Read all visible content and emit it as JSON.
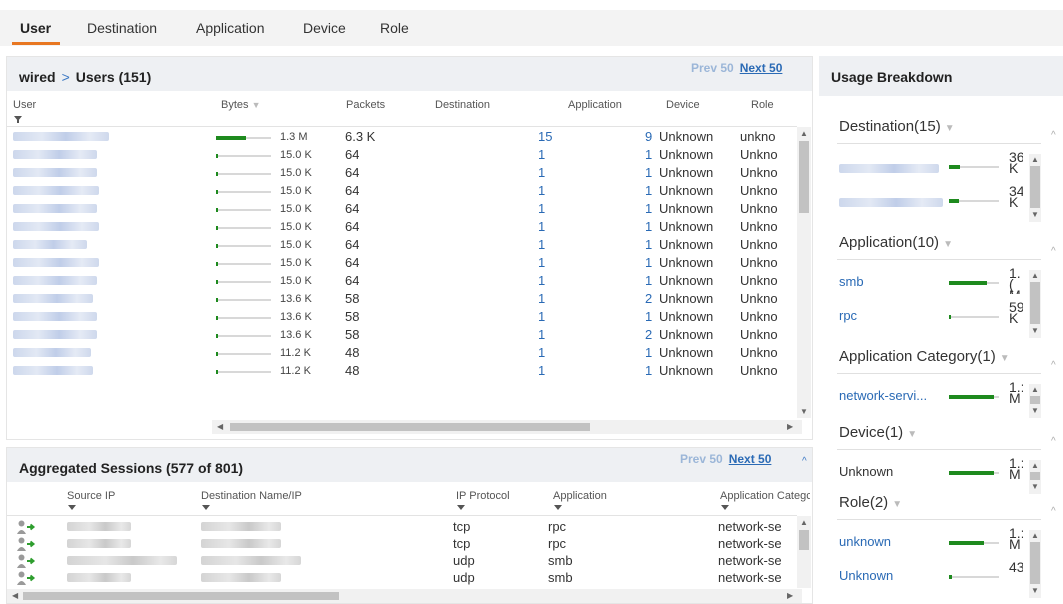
{
  "tabs": [
    "User",
    "Destination",
    "Application",
    "Device",
    "Role"
  ],
  "users_panel": {
    "breadcrumb_root": "wired",
    "breadcrumb_sep": ">",
    "title": "Users (151)",
    "prev": "Prev 50",
    "next": "Next 50",
    "columns": [
      "User",
      "Bytes",
      "Packets",
      "Destination",
      "Application",
      "Device",
      "Role"
    ],
    "rows": [
      {
        "bytes": "1.3 M",
        "bar": 0.55,
        "packets": "6.3 K",
        "destination": "15",
        "application": "9",
        "device": "Unknown",
        "role": "unkno"
      },
      {
        "bytes": "15.0 K",
        "bar": 0.03,
        "packets": "64",
        "destination": "1",
        "application": "1",
        "device": "Unknown",
        "role": "Unkno"
      },
      {
        "bytes": "15.0 K",
        "bar": 0.03,
        "packets": "64",
        "destination": "1",
        "application": "1",
        "device": "Unknown",
        "role": "Unkno"
      },
      {
        "bytes": "15.0 K",
        "bar": 0.03,
        "packets": "64",
        "destination": "1",
        "application": "1",
        "device": "Unknown",
        "role": "Unkno"
      },
      {
        "bytes": "15.0 K",
        "bar": 0.03,
        "packets": "64",
        "destination": "1",
        "application": "1",
        "device": "Unknown",
        "role": "Unkno"
      },
      {
        "bytes": "15.0 K",
        "bar": 0.03,
        "packets": "64",
        "destination": "1",
        "application": "1",
        "device": "Unknown",
        "role": "Unkno"
      },
      {
        "bytes": "15.0 K",
        "bar": 0.03,
        "packets": "64",
        "destination": "1",
        "application": "1",
        "device": "Unknown",
        "role": "Unkno"
      },
      {
        "bytes": "15.0 K",
        "bar": 0.03,
        "packets": "64",
        "destination": "1",
        "application": "1",
        "device": "Unknown",
        "role": "Unkno"
      },
      {
        "bytes": "15.0 K",
        "bar": 0.03,
        "packets": "64",
        "destination": "1",
        "application": "1",
        "device": "Unknown",
        "role": "Unkno"
      },
      {
        "bytes": "13.6 K",
        "bar": 0.03,
        "packets": "58",
        "destination": "1",
        "application": "2",
        "device": "Unknown",
        "role": "Unkno"
      },
      {
        "bytes": "13.6 K",
        "bar": 0.03,
        "packets": "58",
        "destination": "1",
        "application": "1",
        "device": "Unknown",
        "role": "Unkno"
      },
      {
        "bytes": "13.6 K",
        "bar": 0.03,
        "packets": "58",
        "destination": "1",
        "application": "2",
        "device": "Unknown",
        "role": "Unkno"
      },
      {
        "bytes": "11.2 K",
        "bar": 0.03,
        "packets": "48",
        "destination": "1",
        "application": "1",
        "device": "Unknown",
        "role": "Unkno"
      },
      {
        "bytes": "11.2 K",
        "bar": 0.03,
        "packets": "48",
        "destination": "1",
        "application": "1",
        "device": "Unknown",
        "role": "Unkno"
      }
    ]
  },
  "sessions_panel": {
    "title": "Aggregated Sessions (577 of 801)",
    "prev": "Prev 50",
    "next": "Next 50",
    "columns": [
      "Source IP",
      "Destination Name/IP",
      "IP Protocol",
      "Application",
      "Application Categc"
    ],
    "rows": [
      {
        "protocol": "tcp",
        "application": "rpc",
        "category": "network-se"
      },
      {
        "protocol": "tcp",
        "application": "rpc",
        "category": "network-se"
      },
      {
        "protocol": "udp",
        "application": "smb",
        "category": "network-se"
      },
      {
        "protocol": "udp",
        "application": "smb",
        "category": "network-se"
      }
    ]
  },
  "usage": {
    "title": "Usage Breakdown",
    "sections": [
      {
        "title": "Destination(15)",
        "items": [
          {
            "label": "",
            "value": "36 K",
            "bar": 0.22
          },
          {
            "label": "",
            "value": "34 K",
            "bar": 0.2
          }
        ]
      },
      {
        "title": "Application(10)",
        "items": [
          {
            "label": "smb",
            "value": "1.( M",
            "bar": 0.75
          },
          {
            "label": "rpc",
            "value": "59 K",
            "bar": 0.04
          }
        ]
      },
      {
        "title": "Application Category(1)",
        "items": [
          {
            "label": "network-servi...",
            "value": "1.: M",
            "bar": 0.9
          }
        ]
      },
      {
        "title": "Device(1)",
        "items": [
          {
            "label": "Unknown",
            "value": "1.: M",
            "bar": 0.9
          }
        ]
      },
      {
        "title": "Role(2)",
        "items": [
          {
            "label": "unknown",
            "value": "1.: M",
            "bar": 0.7
          },
          {
            "label": "Unknown",
            "value": "43",
            "bar": 0.05
          }
        ]
      }
    ]
  }
}
